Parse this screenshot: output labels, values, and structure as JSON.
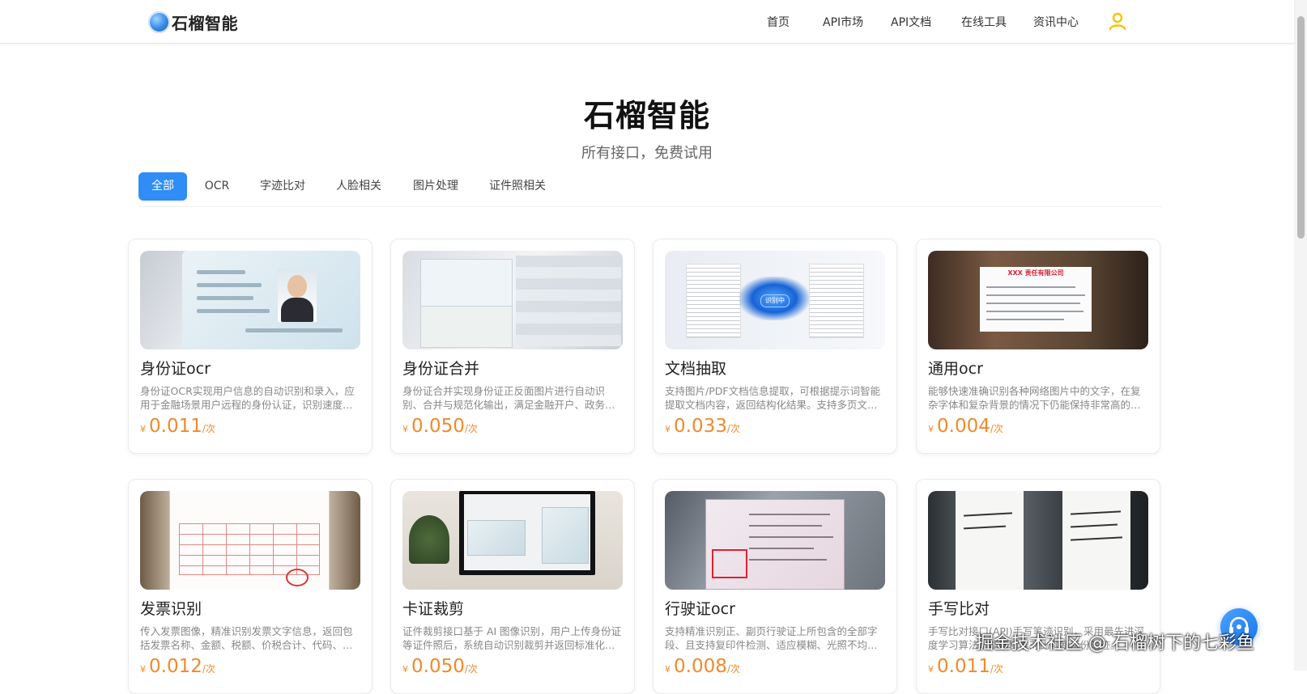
{
  "brand": {
    "name": "石榴智能"
  },
  "nav": {
    "items": [
      "首页",
      "API市场",
      "API文档",
      "在线工具",
      "资讯中心"
    ],
    "user_icon": "user-icon"
  },
  "hero": {
    "title": "石榴智能",
    "subtitle": "所有接口，免费试用"
  },
  "tabs": {
    "active": "全部",
    "items": [
      "全部",
      "OCR",
      "字迹比对",
      "人脸相关",
      "图片处理",
      "证件照相关"
    ]
  },
  "products": [
    {
      "title": "身份证ocr",
      "desc": "身份证OCR实现用户信息的自动识别和录入，应用于金融场景用户远程的身份认证，识别速度快，准确率高。",
      "currency": "¥",
      "price": "0.011",
      "unit": "/次",
      "thumb_badge": ""
    },
    {
      "title": "身份证合并",
      "desc": "身份证合并实现身份证正反面图片进行自动识别、合并与规范化输出，满足金融开户、政务服务 等场景需求。",
      "currency": "¥",
      "price": "0.050",
      "unit": "/次",
      "thumb_badge": ""
    },
    {
      "title": "文档抽取",
      "desc": "支持图片/PDF文档信息提取，可根据提示词智能提取文档内容，返回结构化结果。支持多页文档处理。",
      "currency": "¥",
      "price": "0.033",
      "unit": "/次",
      "thumb_badge": "识别中"
    },
    {
      "title": "通用ocr",
      "desc": "能够快速准确识别各种网络图片中的文字，在复杂字体和复杂背景的情况下仍能保持非常高的识别准确率。",
      "currency": "¥",
      "price": "0.004",
      "unit": "/次",
      "thumb_badge": "XXX 责任有限公司"
    },
    {
      "title": "发票识别",
      "desc": "传入发票图像，精准识别发票文字信息，返回包括发票名称、金额、税额、价税合计、代码、发票号码等字段。",
      "currency": "¥",
      "price": "0.012",
      "unit": "/次",
      "thumb_badge": ""
    },
    {
      "title": "卡证裁剪",
      "desc": "证件裁剪接口基于 AI 图像识别，用户上传身份证等证件照后，系统自动识别裁剪并返回标准化图片结果。",
      "currency": "¥",
      "price": "0.050",
      "unit": "/次",
      "thumb_badge": ""
    },
    {
      "title": "行驶证ocr",
      "desc": "支持精准识别正、副页行驶证上所包含的全部字段、且支持复印件检测、适应模糊、光照不均、倾斜等情况。",
      "currency": "¥",
      "price": "0.008",
      "unit": "/次",
      "thumb_badge": ""
    },
    {
      "title": "手写比对",
      "desc": "手写比对接口(API)手写笔迹识别，采用最先进深度学习算法，能够精准对比判断两份笔迹。",
      "currency": "¥",
      "price": "0.011",
      "unit": "/次",
      "thumb_badge": ""
    }
  ],
  "watermark": "掘金技术社区 @ 石榴树下的七彩鱼",
  "colors": {
    "accent": "#2f8df5",
    "price": "#f08a2c",
    "user_icon": "#f5c400"
  }
}
